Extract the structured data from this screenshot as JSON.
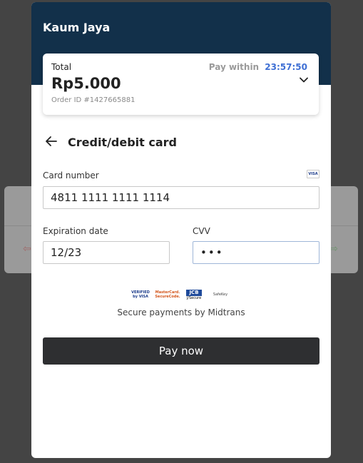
{
  "merchant": {
    "name": "Kaum Jaya"
  },
  "summary": {
    "total_label": "Total",
    "amount": "Rp5.000",
    "order_id": "Order ID #1427665881",
    "pay_within_label": "Pay within",
    "countdown": "23:57:50"
  },
  "payment_method": {
    "title": "Credit/debit card"
  },
  "card_form": {
    "card_number_label": "Card number",
    "card_number_value": "4811 1111 1111 1114",
    "card_brand_badge": "VISA",
    "expiration_label": "Expiration date",
    "expiration_value": "12/23",
    "cvv_label": "CVV",
    "cvv_value": "•••"
  },
  "security": {
    "logos": [
      {
        "icon": "verified-by-visa-logo",
        "line1": "VERIFIED",
        "line2": "by VISA"
      },
      {
        "icon": "mastercard-securecode-logo",
        "line1": "MasterCard.",
        "line2": "SecureCode."
      },
      {
        "icon": "jcb-logo",
        "line1": "JCB",
        "line2": "J/Secure"
      },
      {
        "icon": "safekey-logo",
        "line1": "",
        "line2": "SafeKey"
      }
    ],
    "text": "Secure payments by Midtrans"
  },
  "actions": {
    "pay_label": "Pay now"
  },
  "colors": {
    "header_bg": "#12304a",
    "countdown": "#3e6fd4",
    "pay_button_bg": "#2e2f31",
    "overlay_bg": "#444444"
  }
}
